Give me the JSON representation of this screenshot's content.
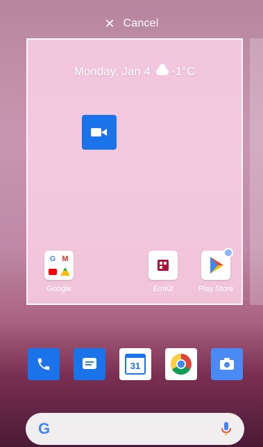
{
  "topbar": {
    "close_glyph": "✕",
    "cancel_label": "Cancel"
  },
  "preview": {
    "date": "Monday, Jan 4",
    "weather_icon": "cloud-icon",
    "temperature": "-1°C",
    "apps": {
      "google": "Google",
      "emkit": "EmKit",
      "play_store": "Play Store"
    }
  },
  "dock": [
    {
      "name": "phone-app",
      "icon": "phone-icon"
    },
    {
      "name": "messages-app",
      "icon": "message-icon"
    },
    {
      "name": "calendar-app",
      "icon": "calendar-icon",
      "label": "31"
    },
    {
      "name": "chrome-app",
      "icon": "chrome-icon"
    },
    {
      "name": "camera-app",
      "icon": "camera-icon"
    }
  ],
  "search": {
    "logo_letter": "G",
    "mic_icon": "mic-icon"
  },
  "colors": {
    "google_blue": "#4285f4",
    "duo_blue": "#1a73e8"
  }
}
